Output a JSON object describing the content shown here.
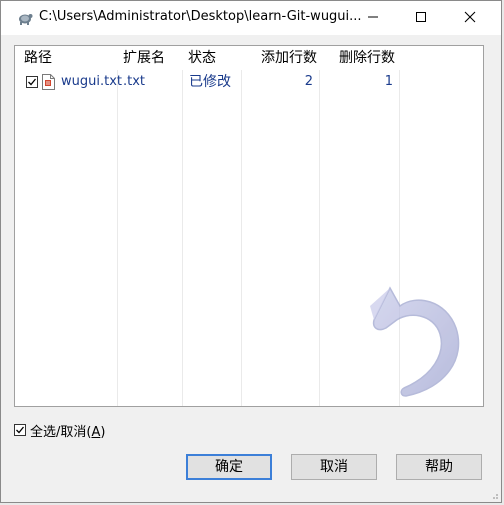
{
  "window": {
    "title": "C:\\Users\\Administrator\\Desktop\\learn-Git-wugui..."
  },
  "columns": [
    "路径",
    "扩展名",
    "状态",
    "添加行数",
    "删除行数"
  ],
  "rows": [
    {
      "checked": true,
      "path": "wugui.txt",
      "extension": ".txt",
      "status": "已修改",
      "added": "2",
      "deleted": "1"
    }
  ],
  "select_all": {
    "checked": true,
    "label": "全选/取消(",
    "mnemonic": "A",
    "label_end": ")"
  },
  "buttons": {
    "ok": "确定",
    "cancel": "取消",
    "help": "帮助"
  },
  "colors": {
    "text_link": "#1a3b8c",
    "default_button_border": "#3c7fd8",
    "dialog_bg": "#f0f0f0"
  },
  "icons": {
    "app": "tortoisegit-icon",
    "file": "text-file-icon",
    "watermark": "undo-arrow-icon"
  }
}
